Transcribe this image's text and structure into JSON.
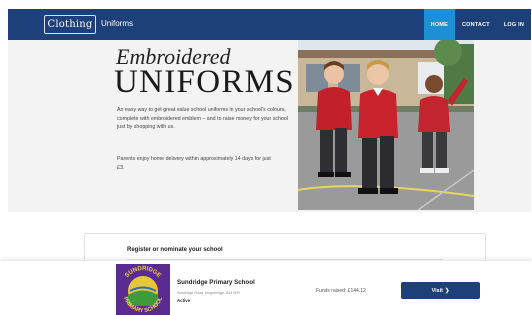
{
  "header": {
    "logo_text": "Clothing",
    "site_title": "Uniforms",
    "nav": [
      {
        "label": "HOME",
        "active": true
      },
      {
        "label": "CONTACT",
        "active": false
      },
      {
        "label": "LOG IN",
        "active": false
      }
    ],
    "colors": {
      "bar": "#1d3f7a",
      "active": "#1f8fd3"
    }
  },
  "hero": {
    "heading_line1": "Embroidered",
    "heading_line2": "UNIFORMS",
    "description": "An easy way to get great value school uniforms in your school's colours, complete with embroidered emblem – and to raise money for your school just by shopping with us.",
    "delivery": "Parents enjoy home delivery within approximately 14 days for just £3."
  },
  "register": {
    "title": "Register or nominate your school"
  },
  "school": {
    "crest_text": "SUNDRIDGE PRIMARY SCHOOL",
    "name": "Sundridge Primary School",
    "address": "Sundridge Road, Kingsbridge, B44 9HY",
    "status": "Active",
    "funds_raised": "Funds raised: £144.12",
    "visit_label": "Visit",
    "visit_icon": "chevron-right-icon"
  }
}
